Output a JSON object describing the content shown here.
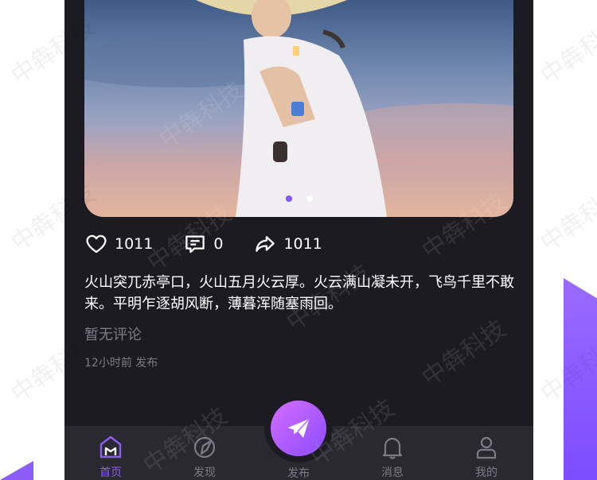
{
  "post": {
    "likes": "1011",
    "comments": "0",
    "shares": "1011",
    "content": "火山突兀赤亭口，火山五月火云厚。火云满山凝未开，飞鸟千里不敢来。平明乍逐胡风断，薄暮浑随塞雨回。",
    "no_comment": "暂无评论",
    "time": "12小时前 发布"
  },
  "tabbar": {
    "home": "首页",
    "discover": "发现",
    "publish": "发布",
    "messages": "消息",
    "mine": "我的"
  },
  "watermark": "中犇科技",
  "colors": {
    "accent": "#8b5cf6",
    "bg": "#1c1b22"
  },
  "icons": [
    "heart-icon",
    "comment-icon",
    "share-icon",
    "home-icon",
    "compass-icon",
    "paper-plane-icon",
    "bell-icon",
    "user-icon"
  ]
}
